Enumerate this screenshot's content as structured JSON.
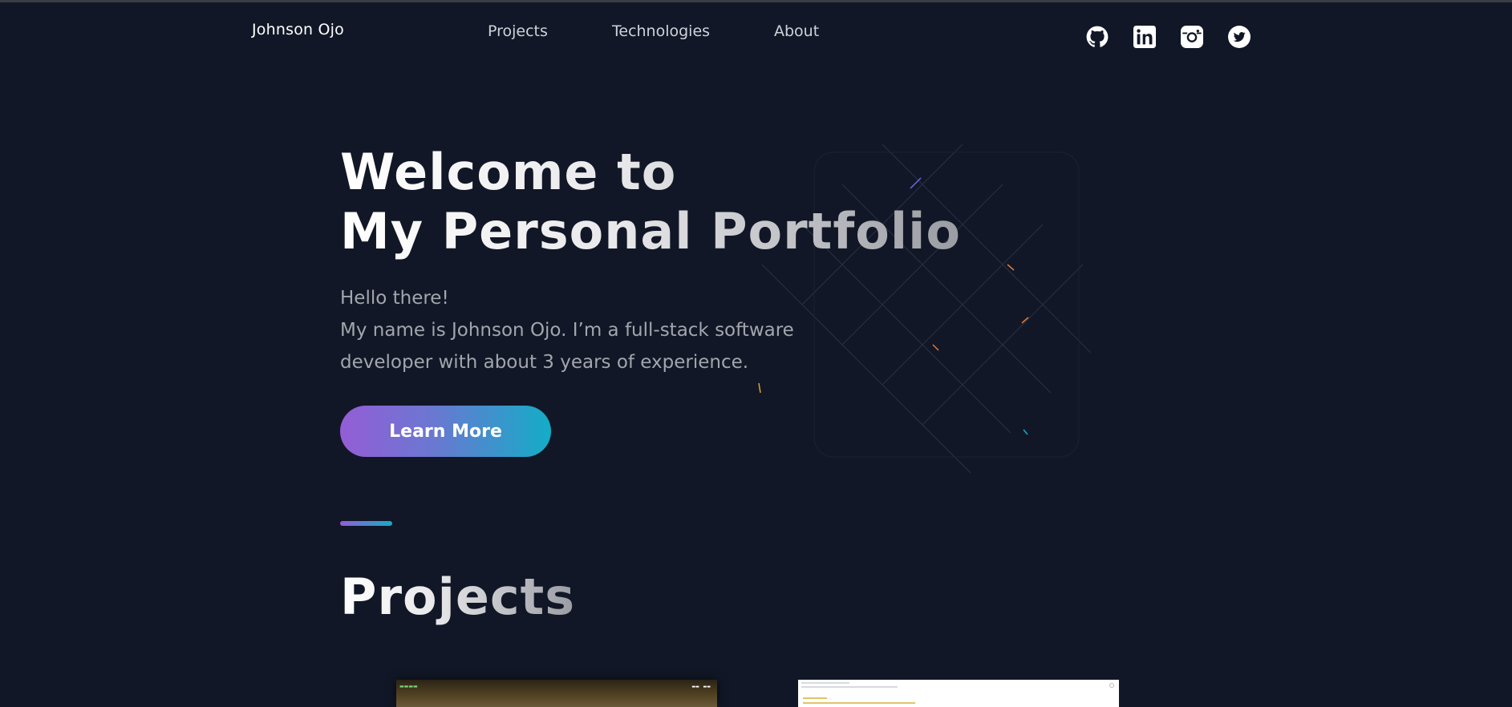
{
  "navbar": {
    "brand": "Johnson Ojo",
    "links": [
      {
        "label": "Projects"
      },
      {
        "label": "Technologies"
      },
      {
        "label": "About"
      }
    ],
    "social": [
      "github-icon",
      "linkedin-icon",
      "instagram-icon",
      "twitter-icon"
    ]
  },
  "hero": {
    "title_line1": "Welcome to",
    "title_line2": "My Personal Portfolio",
    "text_line1": "Hello there!",
    "text_line2": "My name is Johnson Ojo. I’m a full-stack software",
    "text_line3": "developer with about 3 years of experience.",
    "button_label": "Learn More"
  },
  "projects": {
    "title": "Projects"
  },
  "colors": {
    "background": "#111726",
    "gradient_start": "#945dd6",
    "gradient_end": "#13adc7"
  }
}
